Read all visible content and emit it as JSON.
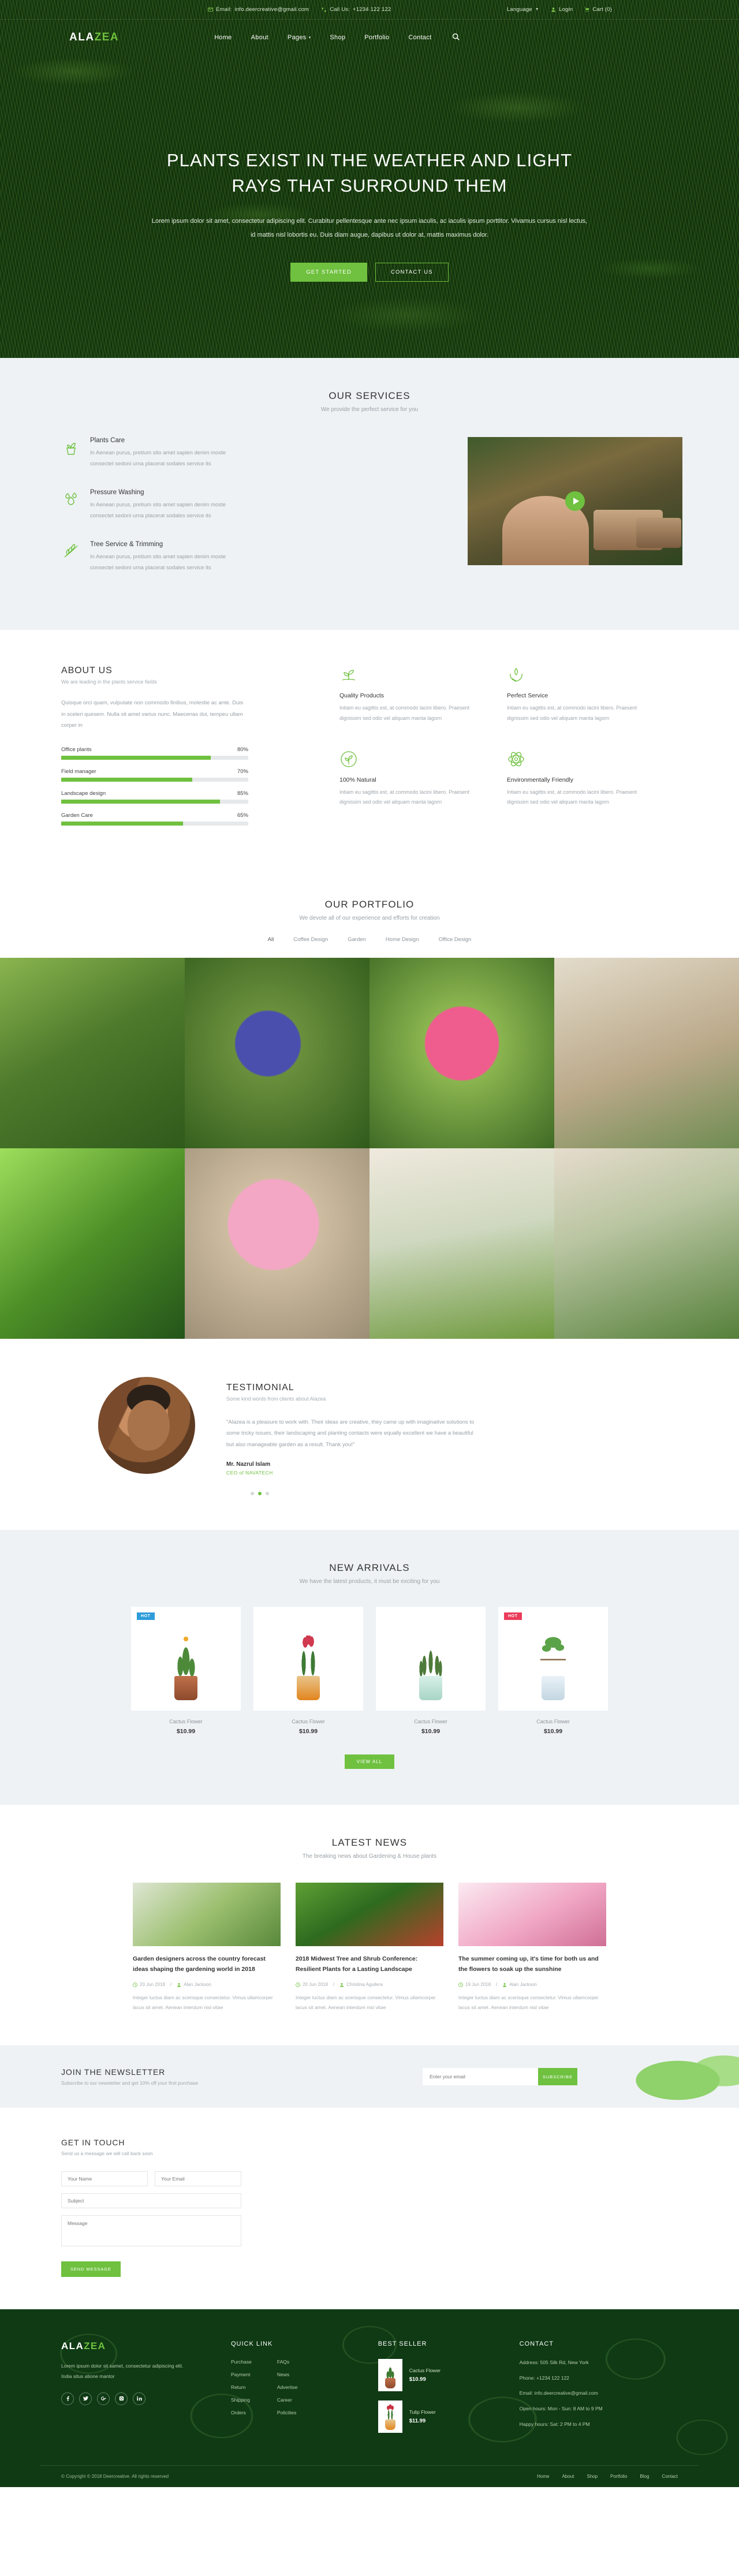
{
  "topbar": {
    "email_label": "Email:",
    "email": "info.deercreative@gmail.com",
    "phone_label": "Call Us:",
    "phone": "+1234 122 122",
    "language": "Language",
    "login": "Login",
    "cart": "Cart (0)"
  },
  "nav": {
    "logo_a": "ALA",
    "logo_z": "ZEA",
    "items": [
      {
        "label": "Home"
      },
      {
        "label": "About"
      },
      {
        "label": "Pages"
      },
      {
        "label": "Shop"
      },
      {
        "label": "Portfolio"
      },
      {
        "label": "Contact"
      }
    ]
  },
  "hero": {
    "title": "PLANTS EXIST IN THE WEATHER AND LIGHT RAYS THAT SURROUND THEM",
    "paragraph": "Lorem ipsum dolor sit amet, consectetur adipiscing elit. Curabitur pellentesque ante nec ipsum iaculis, ac iaculis ipsum porttitor. Vivamus cursus nisl lectus, id mattis nisl lobortis eu. Duis diam augue, dapibus ut dolor at, mattis maximus dolor.",
    "btn_primary": "GET STARTED",
    "btn_secondary": "CONTACT US"
  },
  "services": {
    "title": "OUR SERVICES",
    "subtitle": "We provide the perfect service for you",
    "items": [
      {
        "icon": "potted-plant-icon",
        "title": "Plants Care",
        "text": "In Aenean purus, pretium sito amet sapien denim moste consectet sedoni urna placerat sodales service its"
      },
      {
        "icon": "water-drop-icon",
        "title": "Pressure Washing",
        "text": "In Aenean purus, pretium sito amet sapien denim moste consectet sedoni urna placerat sodales service its"
      },
      {
        "icon": "leaf-branch-icon",
        "title": "Tree Service & Trimming",
        "text": "In Aenean purus, pretium sito amet sapien denim moste consectet sedoni urna placerat sodales service its"
      }
    ]
  },
  "about": {
    "title": "ABOUT US",
    "subtitle": "We are leading in the plants service fields",
    "paragraph": "Quisque orci quam, vulputate non commodo finibus, molestie ac ante. Duis in sceleri quesem. Nulla sit amet varius nunc. Maecenas dui, tempeu ullam corper in",
    "skills": [
      {
        "label": "Office plants",
        "value": "80%",
        "pct": 80
      },
      {
        "label": "Field manager",
        "value": "70%",
        "pct": 70
      },
      {
        "label": "Landscape design",
        "value": "85%",
        "pct": 85
      },
      {
        "label": "Garden Care",
        "value": "65%",
        "pct": 65
      }
    ],
    "features": [
      {
        "icon": "sprout-icon",
        "title": "Quality Products",
        "text": "Intiam eu sagittis est, at commodo lacini libero. Praesent dignissim sed odio vel aliquam manta lagorn"
      },
      {
        "icon": "hands-leaf-icon",
        "title": "Perfect Service",
        "text": "Intiam eu sagittis est, at commodo lacini libero. Praesent dignissim sed odio vel aliquam manta lagorn"
      },
      {
        "icon": "natural-circle-icon",
        "title": "100% Natural",
        "text": "Intiam eu sagittis est, at commodo lacini libero. Praesent dignissim sed odio vel aliquam manta lagorn"
      },
      {
        "icon": "eco-atom-icon",
        "title": "Environmentally Friendly",
        "text": "Intiam eu sagittis est, at commodo lacini libero. Praesent dignissim sed odio vel aliquam manta lagorn"
      }
    ]
  },
  "portfolio": {
    "title": "OUR PORTFOLIO",
    "subtitle": "We devote all of our experience and efforts for creation",
    "filters": [
      "All",
      "Coffee Design",
      "Garden",
      "Home Design",
      "Office Design"
    ],
    "active_filter": "All",
    "cells": [
      {
        "name": "garden-path-photo",
        "color1": "#6f9a3e",
        "color2": "#3d5e22"
      },
      {
        "name": "grape-hyacinth-photo",
        "color1": "#5a7d35",
        "color2": "#2f4a7a"
      },
      {
        "name": "pink-dahlia-photo",
        "color1": "#88b04b",
        "color2": "#d94f7a"
      },
      {
        "name": "indoor-plants-photo",
        "color1": "#cbbfa8",
        "color2": "#7b8c5a"
      },
      {
        "name": "green-fern-photo",
        "color1": "#7fc24a",
        "color2": "#2f6418"
      },
      {
        "name": "pink-peonies-photo",
        "color1": "#b9a98f",
        "color2": "#e79ab8"
      },
      {
        "name": "window-plants-photo",
        "color1": "#dad3c2",
        "color2": "#6f9a3e"
      },
      {
        "name": "hanging-plant-photo",
        "color1": "#d7cbb6",
        "color2": "#5f8a3a"
      }
    ]
  },
  "testimonial": {
    "title": "TESTIMONIAL",
    "subtitle": "Some kind words from clients about Alazea",
    "quote": "\"Alazea is a pleasure to work with. Their ideas are creative, they came up with imaginative solutions to some tricky issues, their landscaping and planting contacts were equally excellent we have a beautiful but also manageable garden as a result. Thank you!\"",
    "name": "Mr. Nazrul Islam",
    "role": "CEO of NAVATECH",
    "dots": 3,
    "active_dot": 1
  },
  "arrivals": {
    "title": "NEW ARRIVALS",
    "subtitle": "We have the latest products, it must be exciting for you",
    "view_all": "VIEW ALL",
    "products": [
      {
        "name": "Cactus Flower",
        "price": "$10.99",
        "badge": "HOT",
        "badge_color": "blue",
        "pot": "#b5643c",
        "leaf": "#4c8a3a"
      },
      {
        "name": "Cactus Flower",
        "price": "$10.99",
        "badge": "",
        "badge_color": "",
        "pot": "#e89a2e",
        "leaf": "#d0394f"
      },
      {
        "name": "Cactus Flower",
        "price": "$10.99",
        "badge": "",
        "badge_color": "",
        "pot": "#b8e0d6",
        "leaf": "#5c8a46"
      },
      {
        "name": "Cactus Flower",
        "price": "$10.99",
        "badge": "HOT",
        "badge_color": "red",
        "pot": "#cfe0ea",
        "leaf": "#5aa348"
      }
    ]
  },
  "news": {
    "title": "LATEST NEWS",
    "subtitle": "The breaking news about Gardening & House plants",
    "posts": [
      {
        "title": "Garden designers across the country forecast ideas shaping the gardening world in 2018",
        "date": "20 Jun 2018",
        "author": "Alan Jackson",
        "text": "Integer luctus diam ac scerisque consectetur. Vimus ullamcorper lacus sit amet. Aenean interdum nisl vitae",
        "c1": "#b7c9a3",
        "c2": "#6f9a3e"
      },
      {
        "title": "2018 Midwest Tree and Shrub Conference: Resilient Plants for a Lasting Landscape",
        "date": "20 Jun 2018",
        "author": "Christina Aguilera",
        "text": "Integer luctus diam ac scerisque consectetur. Vimus ullamcorper lacus sit amet. Aenean interdum nisl vitae",
        "c1": "#4a8a2c",
        "c2": "#c33f2e"
      },
      {
        "title": "The summer coming up, it's time for both us and the flowers to soak up the sunshine",
        "date": "19 Jun 2018",
        "author": "Alan Jackson",
        "text": "Integer luctus diam ac scerisque consectetur. Vimus ullamcorper lacus sit amet. Aenean interdum nisl vitae",
        "c1": "#f2dbe6",
        "c2": "#e07aa0"
      }
    ]
  },
  "newsletter": {
    "title": "JOIN THE NEWSLETTER",
    "subtitle": "Subscribe to our newsletter and get 10% off your first purchase",
    "placeholder": "Enter your email",
    "button": "SUBSCRIBE"
  },
  "contact": {
    "title": "GET IN TOUCH",
    "subtitle": "Send us a message we will call back soon",
    "name_placeholder": "Your Name",
    "email_placeholder": "Your Email",
    "subject_placeholder": "Subject",
    "message_placeholder": "Message",
    "button": "SEND MESSAGE"
  },
  "footer": {
    "logo_a": "ALA",
    "logo_z": "ZEA",
    "about": "Lorem ipsum dolor sit samet, consectetur adipiscing elit. India situs atione mantor",
    "socials": [
      "facebook-icon",
      "twitter-icon",
      "google-plus-icon",
      "instagram-icon",
      "linkedin-icon"
    ],
    "quick_link_title": "QUICK LINK",
    "quick_links_col1": [
      "Purchase",
      "Payment",
      "Return",
      "Shipping",
      "Orders"
    ],
    "quick_links_col2": [
      "FAQs",
      "News",
      "Advertise",
      "Career",
      "Policities"
    ],
    "best_seller_title": "BEST SELLER",
    "best_sellers": [
      {
        "name": "Cactus Flower",
        "price": "$10.99",
        "pot": "#b5643c",
        "leaf": "#3f7a34"
      },
      {
        "name": "Tulip Flower",
        "price": "$11.99",
        "pot": "#e89a2e",
        "leaf": "#c8303f"
      }
    ],
    "contact_title": "CONTACT",
    "contact_lines": [
      "Address: 505 Silk Rd, New York",
      "Phone: +1234 122 122",
      "Email: info.deercreative@gmail.com",
      "Open hours: Mon - Sun: 8 AM to 9 PM",
      "Happy hours: Sat: 2 PM to 4 PM"
    ],
    "copyright": "© Copyright © 2018 Deercreative. All rights reserved",
    "nav": [
      "Home",
      "About",
      "Shop",
      "Portfolio",
      "Blog",
      "Contact"
    ]
  }
}
